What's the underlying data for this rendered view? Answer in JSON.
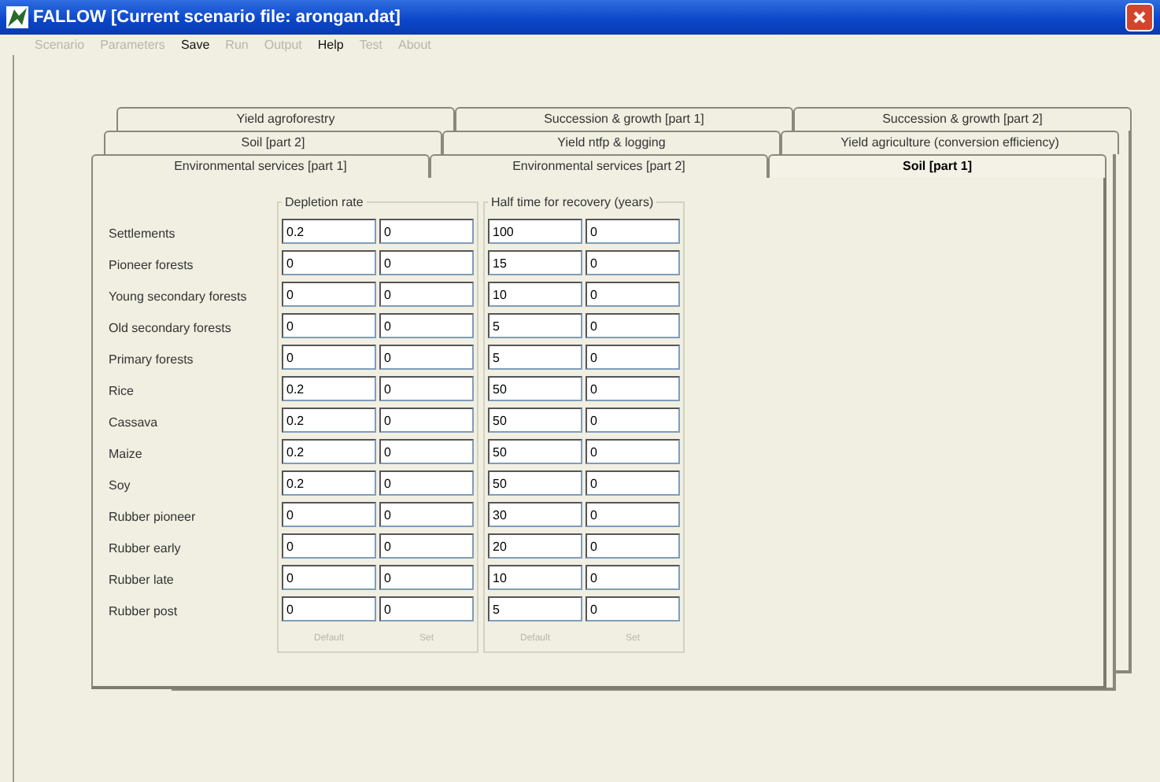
{
  "window": {
    "title": "FALLOW [Current scenario file: arongan.dat]"
  },
  "menu": [
    {
      "label": "Scenario",
      "disabled": true
    },
    {
      "label": "Parameters",
      "disabled": true
    },
    {
      "label": "Save",
      "disabled": false
    },
    {
      "label": "Run",
      "disabled": true
    },
    {
      "label": "Output",
      "disabled": true
    },
    {
      "label": "Help",
      "disabled": false
    },
    {
      "label": "Test",
      "disabled": true
    },
    {
      "label": "About",
      "disabled": true
    }
  ],
  "tab_rows": [
    [
      {
        "label": "Yield agroforestry",
        "selected": false
      },
      {
        "label": "Succession & growth [part 1]",
        "selected": false
      },
      {
        "label": "Succession & growth [part 2]",
        "selected": false
      }
    ],
    [
      {
        "label": "Soil [part 2]",
        "selected": false
      },
      {
        "label": "Yield ntfp & logging",
        "selected": false
      },
      {
        "label": "Yield agriculture (conversion efficiency)",
        "selected": false
      }
    ],
    [
      {
        "label": "Environmental services [part 1]",
        "selected": false
      },
      {
        "label": "Environmental services [part 2]",
        "selected": false
      },
      {
        "label": "Soil [part 1]",
        "selected": true
      }
    ]
  ],
  "rows": [
    "Settlements",
    "Pioneer forests",
    "Young secondary forests",
    "Old secondary forests",
    "Primary forests",
    "Rice",
    "Cassava",
    "Maize",
    "Soy",
    "Rubber pioneer",
    "Rubber early",
    "Rubber late",
    "Rubber post"
  ],
  "groups": [
    {
      "title": "Depletion rate",
      "columns": [
        [
          "0.2",
          "0",
          "0",
          "0",
          "0",
          "0.2",
          "0.2",
          "0.2",
          "0.2",
          "0",
          "0",
          "0",
          "0"
        ],
        [
          "0",
          "0",
          "0",
          "0",
          "0",
          "0",
          "0",
          "0",
          "0",
          "0",
          "0",
          "0",
          "0"
        ]
      ],
      "buttons": [
        {
          "label": "Default",
          "disabled": true
        },
        {
          "label": "Set",
          "disabled": true
        }
      ]
    },
    {
      "title": "Half time for recovery (years)",
      "columns": [
        [
          "100",
          "15",
          "10",
          "5",
          "5",
          "50",
          "50",
          "50",
          "50",
          "30",
          "20",
          "10",
          "5"
        ],
        [
          "0",
          "0",
          "0",
          "0",
          "0",
          "0",
          "0",
          "0",
          "0",
          "0",
          "0",
          "0",
          "0"
        ]
      ],
      "buttons": [
        {
          "label": "Default",
          "disabled": true
        },
        {
          "label": "Set",
          "disabled": true
        }
      ]
    }
  ]
}
